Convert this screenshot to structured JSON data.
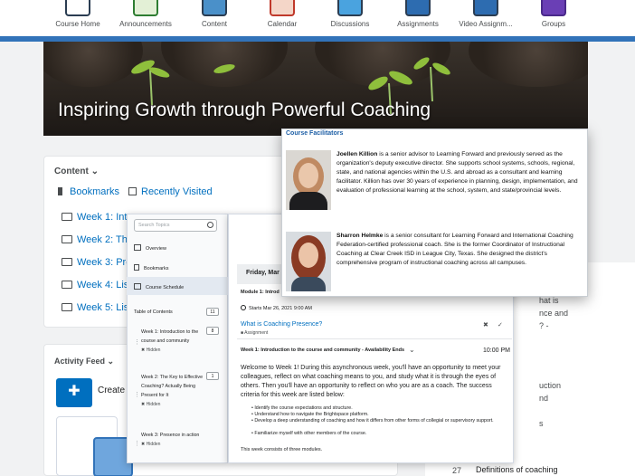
{
  "nav": {
    "items": [
      {
        "label": "Course Home",
        "icon": "course-home-icon"
      },
      {
        "label": "Announcements",
        "icon": "announcements-icon"
      },
      {
        "label": "Content",
        "icon": "content-icon"
      },
      {
        "label": "Calendar",
        "icon": "calendar-icon"
      },
      {
        "label": "Discussions",
        "icon": "discussions-icon"
      },
      {
        "label": "Assignments",
        "icon": "assignments-icon"
      },
      {
        "label": "Video Assignm...",
        "icon": "video-assignments-icon"
      },
      {
        "label": "Groups",
        "icon": "groups-icon"
      }
    ]
  },
  "banner": {
    "title": "Inspiring Growth through Powerful Coaching"
  },
  "content": {
    "heading": "Content",
    "bookmarks": "Bookmarks",
    "recently_visited": "Recently Visited",
    "weeks": [
      "Week 1: Intr",
      "Week 2: The",
      "Week 3: Pre",
      "Week 4: List",
      "Week 5: List"
    ]
  },
  "activity": {
    "heading": "Activity Feed",
    "create": "Create"
  },
  "sidepanel": {
    "search_placeholder": "Search Topics",
    "items": [
      "Overview",
      "Bookmarks",
      "Course Schedule"
    ],
    "toc_label": "Table of Contents",
    "toc_count": "11",
    "modules": [
      {
        "title": "Week 1: Introduction to the course and community",
        "count": "8",
        "status": "Hidden"
      },
      {
        "title": "Week 2: The Key to Effective Coaching? Actually Being Present for It",
        "count": "1",
        "status": "Hidden"
      },
      {
        "title": "Week 3: Presence in action",
        "count": "",
        "status": "Hidden"
      }
    ]
  },
  "main": {
    "date": "Friday, Mar",
    "module_label": "Module 1: Introd",
    "starts": "Starts Mar 26, 2021 9:00 AM",
    "link": "What is Coaching Presence?",
    "link_type": "Assignment",
    "availability": "Week 1: Introduction to the course and community - Availability Ends",
    "time": "10:00 PM",
    "welcome": "Welcome to Week 1! During this asynchronous week, you'll have an opportunity to meet your colleagues, reflect on what coaching means to you, and study what it is through the eyes of others. Then you'll have an opportunity to reflect on who you are as a coach. The success criteria for this week are listed below:",
    "bullets": [
      "Identify the course expectations and structure.",
      "Understand how to navigate the Brightspace platform.",
      "Develop a deep understanding of coaching and how it differs from other forms of collegial or supervisory support.",
      "Familiarize myself with other members of the course."
    ],
    "footer": "This week consists of three modules."
  },
  "facilitators": {
    "title": "Course Facilitators",
    "people": [
      {
        "name": "Joellen Killion",
        "bio": " is a senior advisor to Learning Forward and previously served as the organization's deputy executive director. She supports school systems, schools, regional, state, and national agencies within the U.S. and abroad as a consultant and learning facilitator. Killion has over 30 years of experience in planning, design, implementation, and evaluation of professional learning at the school, system, and state/provincial levels."
      },
      {
        "name": "Sharron Helmke",
        "bio": " is a senior consultant for Learning Forward and International Coaching Federation-certified professional coach. She is the former Coordinator of Instructional Coaching at Clear Creek ISD in League City, Texas. She designed the district's comprehensive program of instructional coaching across all campuses."
      }
    ]
  },
  "right_fragments": [
    "hat is",
    "nce and",
    "? -",
    "uction",
    "nd",
    "s"
  ],
  "right_footer": {
    "number": "27",
    "text": "Definitions of coaching"
  },
  "colors": {
    "brand_blue": "#3273b9",
    "link": "#006fbf",
    "popup_title": "#1c5ea5"
  }
}
